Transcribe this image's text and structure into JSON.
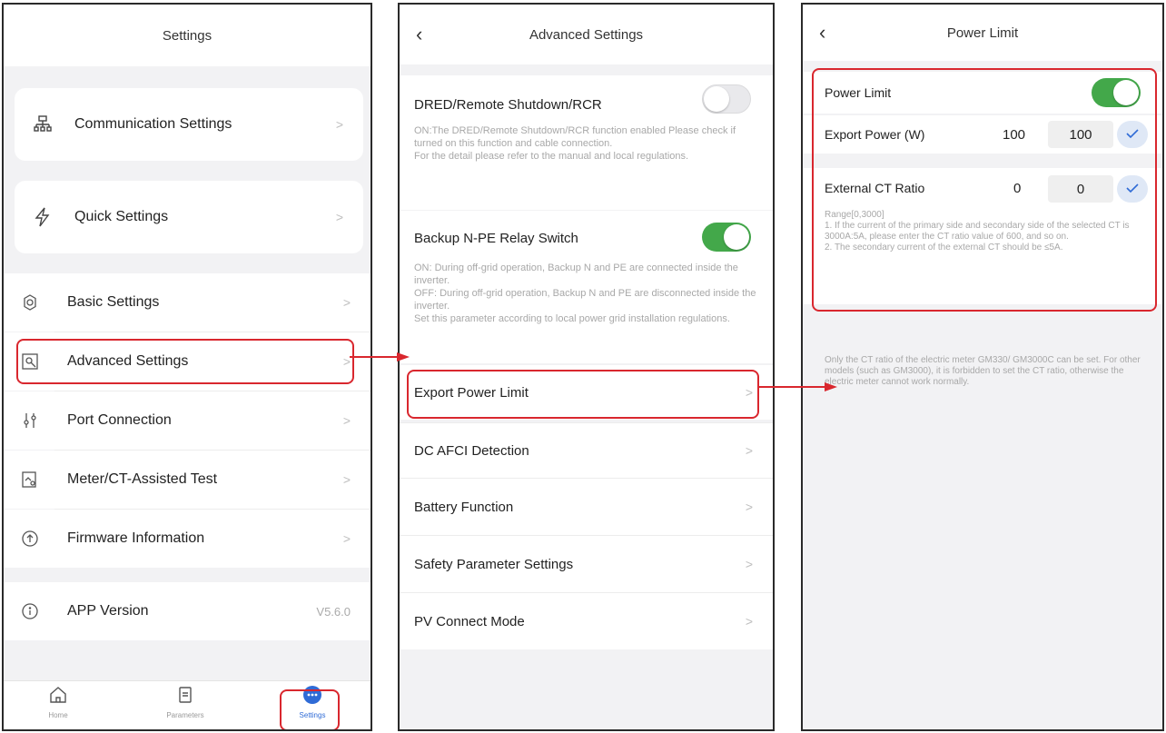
{
  "screen1": {
    "title": "Settings",
    "cards": [
      {
        "label": "Communication Settings",
        "icon": "network-icon"
      },
      {
        "label": "Quick Settings",
        "icon": "lightning-icon"
      }
    ],
    "items": [
      {
        "label": "Basic Settings",
        "icon": "gear-icon"
      },
      {
        "label": "Advanced Settings",
        "icon": "advanced-gear-icon"
      },
      {
        "label": "Port Connection",
        "icon": "port-icon"
      },
      {
        "label": "Meter/CT-Assisted Test",
        "icon": "meter-test-icon"
      },
      {
        "label": "Firmware Information",
        "icon": "firmware-icon"
      }
    ],
    "app_version": {
      "label": "APP Version",
      "value": "V5.6.0"
    },
    "tabs": [
      {
        "label": "Home",
        "icon": "home-icon"
      },
      {
        "label": "Parameters",
        "icon": "document-icon"
      },
      {
        "label": "Settings",
        "icon": "more-icon"
      }
    ]
  },
  "screen2": {
    "title": "Advanced Settings",
    "dred": {
      "label": "DRED/Remote Shutdown/RCR",
      "toggle": "off",
      "desc1": "ON:The DRED/Remote Shutdown/RCR function enabled Please check if turned on this function and cable connection.",
      "desc2": "For the detail please refer to the manual and local regulations."
    },
    "backup": {
      "label": "Backup N-PE Relay Switch",
      "toggle": "on",
      "desc1": "ON: During off-grid operation, Backup N and PE are connected inside the inverter.",
      "desc2": "OFF: During off-grid operation, Backup N and PE are disconnected inside the inverter.",
      "desc3": "Set this parameter according to local power grid installation regulations."
    },
    "items": [
      {
        "label": "Export Power  Limit"
      },
      {
        "label": "DC AFCI Detection"
      },
      {
        "label": "Battery Function"
      },
      {
        "label": "Safety Parameter Settings"
      },
      {
        "label": "PV Connect Mode"
      }
    ]
  },
  "screen3": {
    "title": "Power Limit",
    "power_limit": {
      "label": "Power Limit",
      "toggle": "on"
    },
    "export_power": {
      "label": "Export Power (W)",
      "current": "100",
      "input": "100"
    },
    "ct_ratio": {
      "label": "External CT Ratio",
      "current": "0",
      "input": "0"
    },
    "range_text": "Range[0,3000]",
    "note1": "1. If the current of the primary side and secondary side of the selected CT is 3000A:5A, please enter the CT ratio value of 600, and so on.",
    "note2": "2. The secondary current of the external CT should be ≤5A.",
    "footer_note": "Only the CT ratio of the electric meter GM330/ GM3000C can be set. For other models (such as GM3000), it is forbidden to set the CT ratio, otherwise the electric meter cannot work normally."
  },
  "colors": {
    "highlight": "#d9272e",
    "toggle_on": "#43a84a",
    "accent": "#2f6bd6"
  }
}
